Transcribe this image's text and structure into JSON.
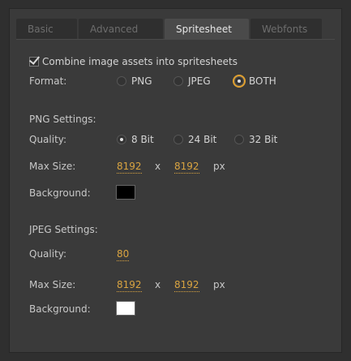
{
  "tabs": [
    "Basic",
    "Advanced",
    "Spritesheet",
    "Webfonts"
  ],
  "combine": {
    "label": "Combine image assets into spritesheets",
    "checked": true
  },
  "format": {
    "label": "Format:",
    "options": [
      "PNG",
      "JPEG",
      "BOTH"
    ],
    "selected": "BOTH"
  },
  "png_settings": {
    "heading": "PNG Settings:",
    "quality_label": "Quality:",
    "quality_options": [
      "8 Bit",
      "24 Bit",
      "32 Bit"
    ],
    "quality_selected": "8 Bit",
    "max_size_label": "Max Size:",
    "max_width": "8192",
    "max_height": "8192",
    "x": "x",
    "unit": "px",
    "background_label": "Background:",
    "background_color": "#000000"
  },
  "jpeg_settings": {
    "heading": "JPEG Settings:",
    "quality_label": "Quality:",
    "quality_value": "80",
    "max_size_label": "Max Size:",
    "max_width": "8192",
    "max_height": "8192",
    "x": "x",
    "unit": "px",
    "background_label": "Background:",
    "background_color": "#ffffff"
  },
  "colors": {
    "accent": "#d9a441",
    "panel": "#3a3a3a",
    "tab_active": "#4a4a4a"
  }
}
